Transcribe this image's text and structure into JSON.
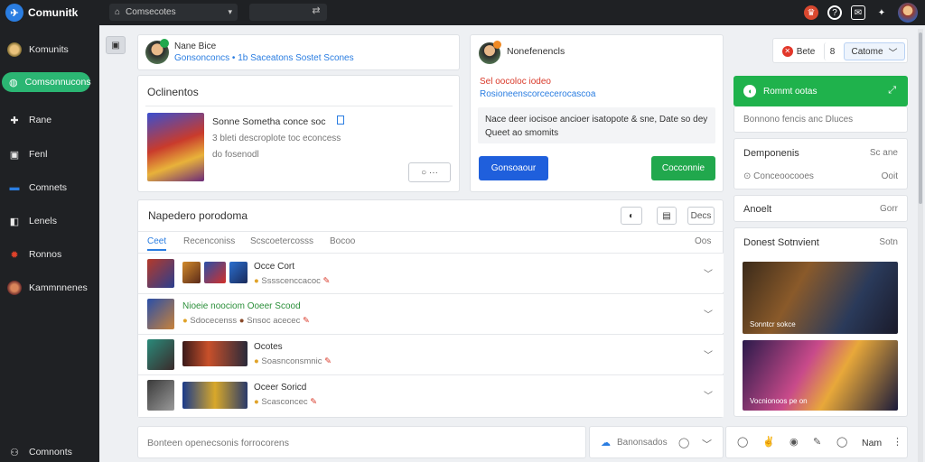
{
  "app": {
    "title": "Comunitk"
  },
  "topbar": {
    "search_text": "Comsecotes"
  },
  "sidebar": {
    "items": [
      {
        "label": "Komunits",
        "icon": "user-avatar-icon"
      },
      {
        "label": "Comsonnucons",
        "icon": "compass-icon"
      },
      {
        "label": "Rane",
        "icon": "fire-icon"
      },
      {
        "label": "Fenl",
        "icon": "square-icon"
      },
      {
        "label": "Comnets",
        "icon": "chat-icon"
      },
      {
        "label": "Lenels",
        "icon": "tag-icon"
      },
      {
        "label": "Ronnos",
        "icon": "bug-icon"
      },
      {
        "label": "Kammnnenes",
        "icon": "person-icon"
      }
    ],
    "bottom_label": "Comnonts"
  },
  "profile_card": {
    "name": "Nane Bice",
    "subtitle": "Gonsonconcs • 1b Saceatons Sostet Scones"
  },
  "post_card": {
    "heading": "Oclinentos",
    "title": "Sonne Sometha conce soc",
    "meta": "3 bleti descroplote toc econcess",
    "footer": "do fosenodl"
  },
  "notif_card": {
    "title": "Nonefenencls",
    "line1": "Sel oocoloc iodeo",
    "line2": "Rosioneenscorcecerocascoa",
    "body": "Nace deer iocisoe ancioer isatopote & sne, Date so dey Queet ao smomits",
    "btn_primary": "Gonsoaour",
    "btn_secondary": "Cocconnie"
  },
  "right_panel": {
    "bette": "Bete",
    "catome": "Catome",
    "green_title": "Rommt ootas",
    "hint": "Bonnono fencis anc Dluces",
    "comments_title": "Demponenis",
    "comments_meta": "Sc ane",
    "comments_sub": "Conceoocooes",
    "comments_num": "Ooit",
    "about": "Anoelt",
    "about_meta": "Gorr",
    "feat_title": "Donest Sotnvient",
    "feat_meta": "Sotn",
    "feat1": "Sonntcr sokce",
    "feat2": "Vocnionoos pe on"
  },
  "list": {
    "title": "Napedero porodoma",
    "tabs": [
      "Ceet",
      "Recenconiss",
      "Scscoetercosss",
      "Bocoo"
    ],
    "right_link": "Oos",
    "filter_label": "Decs",
    "rows": [
      {
        "title": "Occe Cort",
        "meta": "Sssscenccacoc"
      },
      {
        "title": "Nioeie noociom Ooeer Scood",
        "meta": "Sdocecenss",
        "meta2": "Snsoc acecec"
      },
      {
        "title": "Ocotes",
        "meta": "Soasnconsmnic"
      },
      {
        "title": "Oceer Soricd",
        "meta": "Scasconcec"
      }
    ]
  },
  "footer": {
    "text": "Bonteen openecsonis forrocorens",
    "mid": "Banonsados",
    "nam": "Nam"
  },
  "colors": {
    "accent": "#2a7de1",
    "green": "#21a84d",
    "sidebar": "#1f2124"
  }
}
